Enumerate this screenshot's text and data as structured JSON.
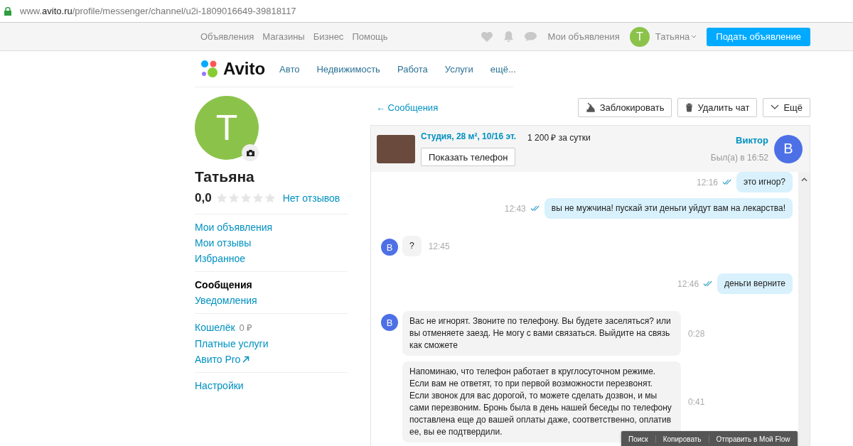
{
  "address_bar": {
    "prefix": "www.",
    "domain": "avito.ru",
    "path": "/profile/messenger/channel/u2i-1809016649-39818117"
  },
  "top_nav": {
    "links": [
      "Объявления",
      "Магазины",
      "Бизнес",
      "Помощь"
    ],
    "my_ads": "Мои объявления",
    "user_initial": "Т",
    "user_name": "Татьяна",
    "post_button": "Подать объявление"
  },
  "logo": {
    "text": "Avito"
  },
  "categories": [
    "Авто",
    "Недвижимость",
    "Работа",
    "Услуги",
    "ещё..."
  ],
  "profile": {
    "initial": "Т",
    "name": "Татьяна",
    "rating": "0,0",
    "stars": 0,
    "reviews_link": "Нет отзывов"
  },
  "sidebar": {
    "groups": [
      [
        {
          "label": "Мои объявления",
          "selected": false
        },
        {
          "label": "Мои отзывы",
          "selected": false
        },
        {
          "label": "Избранное",
          "selected": false
        }
      ],
      [
        {
          "label": "Сообщения",
          "selected": true
        },
        {
          "label": "Уведомления",
          "selected": false
        }
      ],
      [
        {
          "label": "Кошелёк",
          "value": "0 ₽",
          "selected": false
        },
        {
          "label": "Платные услуги",
          "selected": false
        },
        {
          "label": "Авито Pro",
          "external": true,
          "selected": false
        }
      ],
      [
        {
          "label": "Настройки",
          "selected": false
        }
      ]
    ]
  },
  "chat": {
    "back_link": "← Сообщения",
    "actions": [
      {
        "kind": "block",
        "label": "Заблокировать"
      },
      {
        "kind": "delete",
        "label": "Удалить чат"
      },
      {
        "kind": "more",
        "label": "Ещё"
      }
    ],
    "listing": {
      "title": "Студия, 28 м², 10/16 эт.",
      "price": "1 200 ₽ за сутки",
      "show_phone": "Показать телефон"
    },
    "contact": {
      "name": "Виктор",
      "last_seen": "Был(а) в 16:52",
      "initial": "В"
    },
    "messages": [
      {
        "kind": "out",
        "text": "это игнор?",
        "time": "12:16",
        "read": true
      },
      {
        "kind": "out",
        "text": "вы не мужчина! пускай эти деньги уйдут вам на лекарства!",
        "time": "12:43",
        "read": true
      },
      {
        "kind": "in",
        "avatar": "В",
        "text": "?",
        "time": "12:45"
      },
      {
        "kind": "out",
        "text": "деньги верните",
        "time": "12:46",
        "read": true
      },
      {
        "kind": "in",
        "avatar": "В",
        "text": "Вас не игнорят. Звоните по телефону. Вы будете заселяться? или вы отменяете заезд. Не могу с вами связаться. Выйдите на связь как сможете",
        "time": "0:28"
      },
      {
        "kind": "in",
        "text": "Напоминаю, что телефон работает в круглосуточном режиме. Если вам не ответят, то при первой возможности перезвонят. Если звонок для вас дорогой, то можете сделать дозвон, и мы сами перезвоним. Бронь была в день нашей беседы по телефону поставлена еще до вашей оплаты даже, соответственно, оплатив ее, вы ее подтвердили.",
        "time": "0:41"
      }
    ],
    "context_menu": [
      "Поиск",
      "Копировать",
      "Отправить в Мой Flow"
    ]
  }
}
